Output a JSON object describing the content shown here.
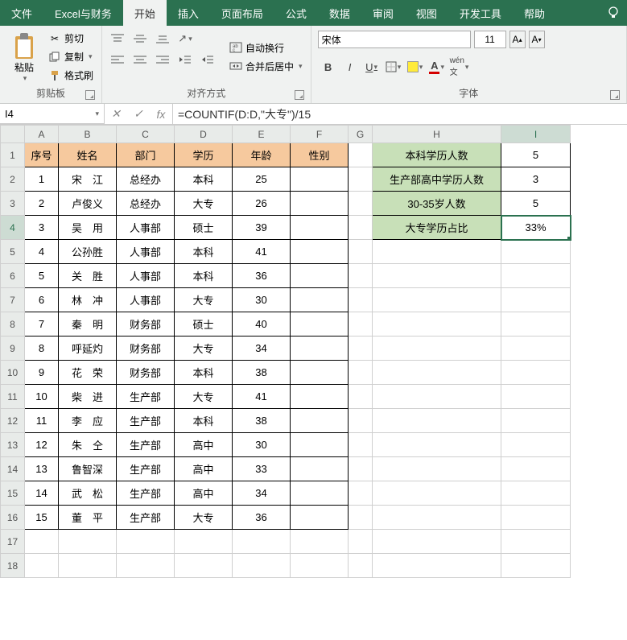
{
  "menu": {
    "items": [
      "文件",
      "Excel与财务",
      "开始",
      "插入",
      "页面布局",
      "公式",
      "数据",
      "审阅",
      "视图",
      "开发工具",
      "帮助"
    ],
    "active": 2
  },
  "ribbon": {
    "clipboard": {
      "paste": "粘贴",
      "cut": "剪切",
      "copy": "复制",
      "format_painter": "格式刷",
      "group": "剪贴板"
    },
    "alignment": {
      "wrap": "自动换行",
      "merge": "合并后居中",
      "group": "对齐方式"
    },
    "font": {
      "name": "宋体",
      "size": "11",
      "group": "字体"
    }
  },
  "formula_bar": {
    "cell_ref": "I4",
    "formula": "=COUNTIF(D:D,\"大专\")/15"
  },
  "columns": [
    "A",
    "B",
    "C",
    "D",
    "E",
    "F",
    "G",
    "H",
    "I"
  ],
  "headers": [
    "序号",
    "姓名",
    "部门",
    "学历",
    "年龄",
    "性别"
  ],
  "rows": [
    {
      "n": "1",
      "name": "宋　江",
      "dept": "总经办",
      "edu": "本科",
      "age": "25",
      "sex": ""
    },
    {
      "n": "2",
      "name": "卢俊义",
      "dept": "总经办",
      "edu": "大专",
      "age": "26",
      "sex": ""
    },
    {
      "n": "3",
      "name": "吴　用",
      "dept": "人事部",
      "edu": "硕士",
      "age": "39",
      "sex": ""
    },
    {
      "n": "4",
      "name": "公孙胜",
      "dept": "人事部",
      "edu": "本科",
      "age": "41",
      "sex": ""
    },
    {
      "n": "5",
      "name": "关　胜",
      "dept": "人事部",
      "edu": "本科",
      "age": "36",
      "sex": ""
    },
    {
      "n": "6",
      "name": "林　冲",
      "dept": "人事部",
      "edu": "大专",
      "age": "30",
      "sex": ""
    },
    {
      "n": "7",
      "name": "秦　明",
      "dept": "财务部",
      "edu": "硕士",
      "age": "40",
      "sex": ""
    },
    {
      "n": "8",
      "name": "呼延灼",
      "dept": "财务部",
      "edu": "大专",
      "age": "34",
      "sex": ""
    },
    {
      "n": "9",
      "name": "花　荣",
      "dept": "财务部",
      "edu": "本科",
      "age": "38",
      "sex": ""
    },
    {
      "n": "10",
      "name": "柴　进",
      "dept": "生产部",
      "edu": "大专",
      "age": "41",
      "sex": ""
    },
    {
      "n": "11",
      "name": "李　应",
      "dept": "生产部",
      "edu": "本科",
      "age": "38",
      "sex": ""
    },
    {
      "n": "12",
      "name": "朱　仝",
      "dept": "生产部",
      "edu": "高中",
      "age": "30",
      "sex": ""
    },
    {
      "n": "13",
      "name": "鲁智深",
      "dept": "生产部",
      "edu": "高中",
      "age": "33",
      "sex": ""
    },
    {
      "n": "14",
      "name": "武　松",
      "dept": "生产部",
      "edu": "高中",
      "age": "34",
      "sex": ""
    },
    {
      "n": "15",
      "name": "董　平",
      "dept": "生产部",
      "edu": "大专",
      "age": "36",
      "sex": ""
    }
  ],
  "summary": [
    {
      "label": "本科学历人数",
      "value": "5"
    },
    {
      "label": "生产部高中学历人数",
      "value": "3"
    },
    {
      "label": "30-35岁人数",
      "value": "5"
    },
    {
      "label": "大专学历占比",
      "value": "33%"
    }
  ],
  "selected": {
    "row": 4,
    "col": "I"
  }
}
